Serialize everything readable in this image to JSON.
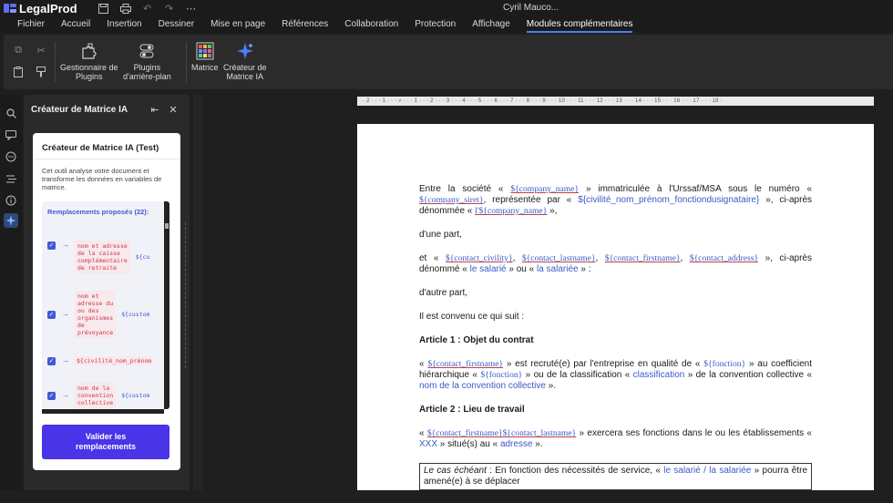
{
  "app": {
    "name": "LegalProd",
    "user": "Cyril Mauco..."
  },
  "menu": [
    "Fichier",
    "Accueil",
    "Insertion",
    "Dessiner",
    "Mise en page",
    "Références",
    "Collaboration",
    "Protection",
    "Affichage",
    "Modules complémentaires"
  ],
  "ribbon": {
    "plugins_manager": "Gestionnaire de\nPlugins",
    "background_plugins": "Plugins\nd'arrière-plan",
    "matrix": "Matrice",
    "ai_matrix": "Créateur de\nMatrice IA"
  },
  "panel": {
    "title": "Créateur de Matrice IA",
    "card_title": "Créateur de Matrice IA (Test)",
    "description": "Cet outil analyse votre document et transforme les données en variables de matrice.",
    "replacements_title": "Remplacements proposés (22):",
    "replacements": [
      {
        "original": "nom et adresse\nde la caisse\ncomplémentaire\nde retraite",
        "replacement": "${cu"
      },
      {
        "original": "nom et\nadresse du\nou des\norganismes\nde\nprévoyance",
        "replacement": "${custom"
      },
      {
        "original": "${civilité_nom_prénom",
        "replacement": ""
      },
      {
        "original": "nom de la\nconvention\ncollective",
        "replacement": "${custom"
      }
    ],
    "validate_label": "Valider les\nremplacements"
  },
  "ruler": "· 2 · · · 1 · · · ▿ · · · 1 · · · 2 · · · 3 · · · 4 · · · 5 · · · 6 · · · 7 · · · 8 · · · 9 · · · 10 · · · 11 · · · 12 · · · 13 · · · 14 · · · 15 · · · 16 · · · 17 · · · 18 ·",
  "document": {
    "p1": {
      "t1": "Entre la société « ",
      "v1": "${company_name}",
      "t2": " » immatriculée à l'Urssaf/MSA sous le numéro « ",
      "v2": "${company_siret}",
      "t3": ", représentée par « ",
      "v3": "${civilité_nom_prénom_fonctiondusignataire}",
      "t4": " », ci-après dénommée « ",
      "v4": "l'${company_name}",
      "t5": " »,"
    },
    "p2": "d'une part,",
    "p3": {
      "t1": "et « ",
      "v1": "${contact_civility}",
      "s1": ", ",
      "v2": "${contact_lastname}",
      "s2": ", ",
      "v3": "${contact_firstname}",
      "s3": ", ",
      "v4": "${contact_address}",
      "t2": " », ci-après dénommé « ",
      "b1": "le salarié",
      "t3": " » ou « ",
      "b2": "la salariée",
      "t4": " » :"
    },
    "p4": "d'autre part,",
    "p5": "Il est convenu ce qui suit :",
    "h1": "Article 1 : Objet du contrat",
    "p6": {
      "t1": "« ",
      "v1": "${contact_firstname}",
      "t2": " » est recruté(e) par l'entreprise en qualité de « ",
      "v2": "${fonction}",
      "t3": " » au coefficient hiérarchique « ",
      "v3": "${fonction}",
      "t4": " » ou de la classification « ",
      "b1": "classification",
      "t5": " » de la convention collective « ",
      "b2": "nom de la convention collective",
      "t6": " »."
    },
    "h2": "Article 2 : Lieu de travail",
    "p7": {
      "t1": "« ",
      "v1": "${contact_firstname}",
      "v2": "${contact_lastname}",
      "t2": " » exercera ses fonctions dans le ou les établissements « ",
      "b1": "XXX",
      "t3": " » situé(s) au « ",
      "b2": "adresse",
      "t4": " »."
    },
    "p8": {
      "i1": "Le cas échéant",
      "t1": " : En fonction des nécessités de service, « ",
      "b1": "le salarié / la salariée",
      "t2": " » pourra être amené(e) à se déplacer"
    }
  }
}
